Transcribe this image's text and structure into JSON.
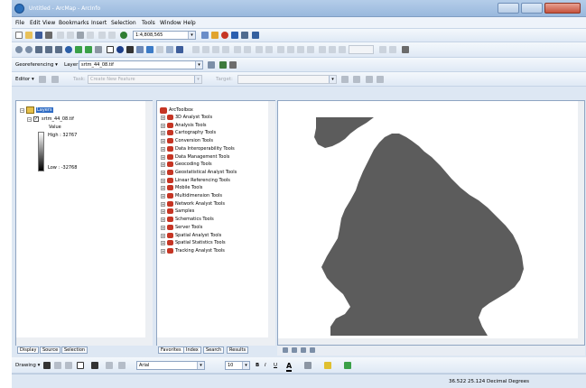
{
  "window": {
    "title": "Untitled - ArcMap - ArcInfo"
  },
  "menu": [
    "File",
    "Edit",
    "View",
    "Bookmarks",
    "Insert",
    "Selection",
    "Tools",
    "Window",
    "Help"
  ],
  "standard_toolbar": {
    "scale": "1:4,808,565"
  },
  "georef_toolbar": {
    "label": "Georeferencing ▾",
    "layer_label": "Layer:",
    "layer_value": "srtm_44_08.tif"
  },
  "editor_toolbar": {
    "editor_label": "Editor ▾",
    "task_label": "Task:",
    "task_value": "Create New Feature",
    "target_label": "Target:"
  },
  "toc": {
    "root": "Layers",
    "layer": "srtm_44_08.tif",
    "value_label": "Value",
    "high": "High : 32767",
    "low": "Low : -32768",
    "tabs": [
      "Display",
      "Source",
      "Selection"
    ]
  },
  "toolbox": {
    "root": "ArcToolbox",
    "tools": [
      "3D Analyst Tools",
      "Analysis Tools",
      "Cartography Tools",
      "Conversion Tools",
      "Data Interoperability Tools",
      "Data Management Tools",
      "Geocoding Tools",
      "Geostatistical Analyst Tools",
      "Linear Referencing Tools",
      "Mobile Tools",
      "Multidimension Tools",
      "Network Analyst Tools",
      "Samples",
      "Schematics Tools",
      "Server Tools",
      "Spatial Analyst Tools",
      "Spatial Statistics Tools",
      "Tracking Analyst Tools"
    ],
    "tabs": [
      "Favorites",
      "Index",
      "Search",
      "Results"
    ]
  },
  "drawing_toolbar": {
    "drawing_label": "Drawing ▾",
    "font": "Arial",
    "size": "10"
  },
  "status": {
    "coords": "36.522  25.124 Decimal Degrees"
  },
  "colors": {
    "land": "#5c5c5c",
    "sea": "#ffffff",
    "toolbox_icon": "#c53524"
  }
}
